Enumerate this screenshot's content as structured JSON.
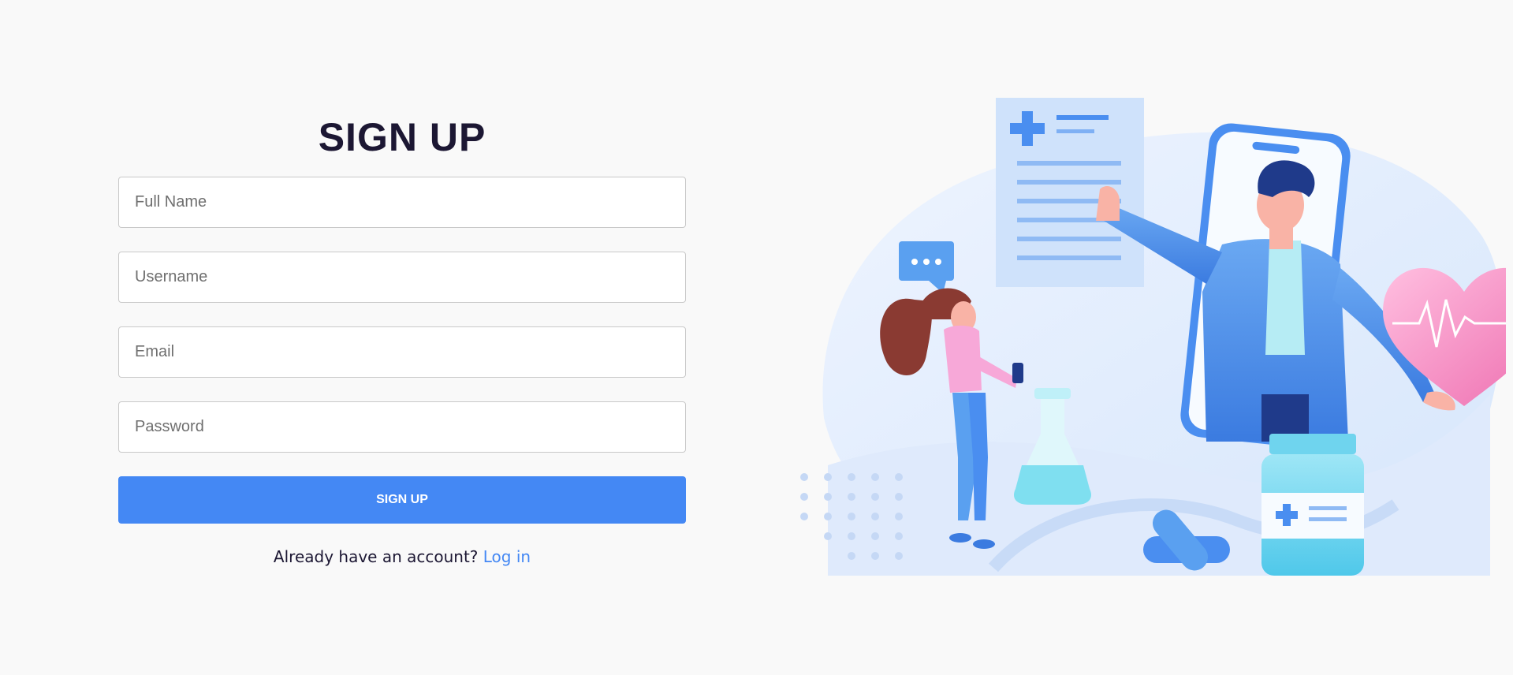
{
  "signup": {
    "title": "SIGN UP",
    "fields": {
      "full_name_placeholder": "Full Name",
      "username_placeholder": "Username",
      "email_placeholder": "Email",
      "password_placeholder": "Password"
    },
    "submit_label": "SIGN UP",
    "footer_text": "Already have an account?",
    "login_link": "Log in"
  },
  "colors": {
    "background": "#f9f9f9",
    "accent": "#4488f4",
    "title": "#1c1733"
  },
  "illustration": {
    "icons": [
      "medical-document-icon",
      "chat-bubble-icon",
      "heart-pulse-icon",
      "flask-icon",
      "medicine-bottle-icon",
      "pill-icon"
    ]
  }
}
